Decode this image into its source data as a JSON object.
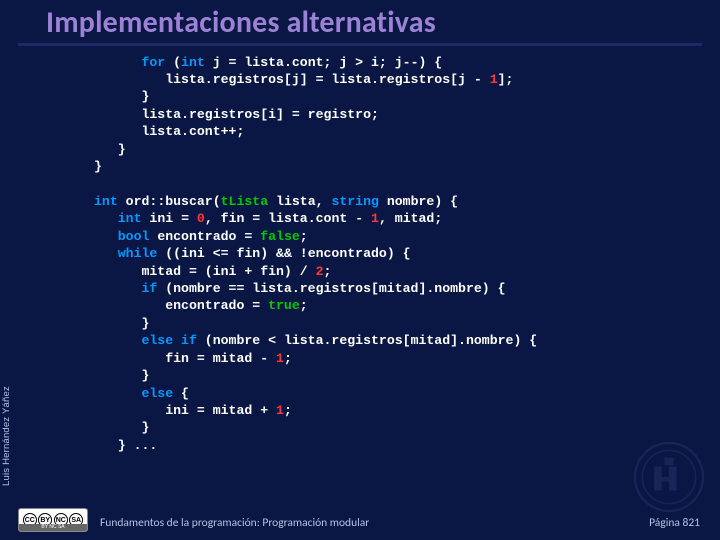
{
  "title": "Implementaciones alternativas",
  "author": "Luis Hernández Yáñez",
  "footer": {
    "left": "Fundamentos de la programación: Programación modular",
    "right": "Página 821"
  },
  "cc": {
    "cc": "CC",
    "by": "BY",
    "nc": "NC",
    "sa": "SA",
    "label": "BY  NC  SA"
  },
  "code": {
    "l01_a": "      ",
    "l01_kw1": "for",
    "l01_b": " (",
    "l01_kw2": "int",
    "l01_c": " j = lista.cont; j > i; j--) {",
    "l02": "         lista.registros[j] = lista.registros[j - ",
    "l02_num": "1",
    "l02_b": "];",
    "l03": "      }",
    "l04": "      lista.registros[i] = registro;",
    "l05": "      lista.cont++;",
    "l06": "   }",
    "l07": "}",
    "l08": "",
    "l09_kw1": "int",
    "l09_a": " ord::buscar(",
    "l09_typ": "tLista",
    "l09_b": " lista, ",
    "l09_kw2": "string",
    "l09_c": " nombre) {",
    "l10_a": "   ",
    "l10_kw": "int",
    "l10_b": " ini = ",
    "l10_n1": "0",
    "l10_c": ", fin = lista.cont - ",
    "l10_n2": "1",
    "l10_d": ", mitad;",
    "l11_a": "   ",
    "l11_kw": "bool",
    "l11_b": " encontrado = ",
    "l11_v": "false",
    "l11_c": ";",
    "l12_a": "   ",
    "l12_kw": "while",
    "l12_b": " ((ini <= fin) && !encontrado) {",
    "l13_a": "      mitad = (ini + fin) / ",
    "l13_n": "2",
    "l13_b": ";",
    "l14_a": "      ",
    "l14_kw": "if",
    "l14_b": " (nombre == lista.registros[mitad].nombre) {",
    "l15_a": "         encontrado = ",
    "l15_v": "true",
    "l15_b": ";",
    "l16": "      }",
    "l17_a": "      ",
    "l17_kw": "else if",
    "l17_b": " (nombre < lista.registros[mitad].nombre) {",
    "l18_a": "         fin = mitad - ",
    "l18_n": "1",
    "l18_b": ";",
    "l19": "      }",
    "l20_a": "      ",
    "l20_kw": "else",
    "l20_b": " {",
    "l21_a": "         ini = mitad + ",
    "l21_n": "1",
    "l21_b": ";",
    "l22": "      }",
    "l23": "   } ..."
  }
}
